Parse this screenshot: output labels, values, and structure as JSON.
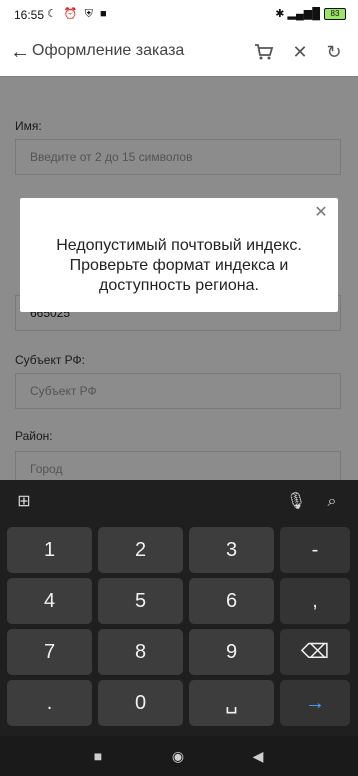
{
  "status_bar": {
    "time": "16:55",
    "left_icons": "☾ ⏰ ⛨ ■",
    "right_icons": "✱ ▂▄▆█",
    "battery": "83"
  },
  "toolbar": {
    "title": "Оформление заказа"
  },
  "form": {
    "name_label": "Имя:",
    "name_placeholder": "Введите от 2 до 15 символов",
    "index_value": "665025",
    "subject_label": "Субъект РФ:",
    "subject_placeholder": "Субъект РФ",
    "district_label": "Район:",
    "district_placeholder": "Город"
  },
  "dialog": {
    "message": "Недопустимый почтовый индекс. Проверьте формат индекса и доступность региона."
  },
  "keyboard": {
    "keys": [
      [
        "1",
        "2",
        "3",
        "-"
      ],
      [
        "4",
        "5",
        "6",
        ","
      ],
      [
        "7",
        "8",
        "9",
        "⌫"
      ],
      [
        ".",
        "0",
        "␣",
        "→"
      ]
    ]
  }
}
